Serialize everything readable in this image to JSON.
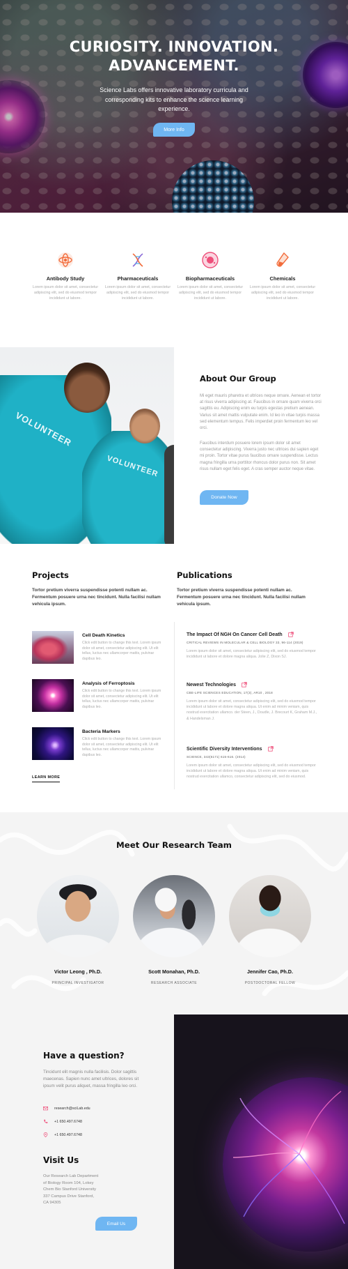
{
  "hero": {
    "title_line1": "CURIOSITY. INNOVATION.",
    "title_line2": "ADVANCEMENT.",
    "subtitle": "Science Labs offers innovative laboratory curricula and corresponding kits to enhance the science learning experience.",
    "button_label": "More Info"
  },
  "features": [
    {
      "title": "Antibody Study",
      "text": "Lorem ipsum dolor sit amet, consectetur adipiscing elit, sed do eiusmod tempor incididunt ut labore.",
      "icon": "atom-icon",
      "color": "#f26b3a"
    },
    {
      "title": "Pharmaceuticals",
      "text": "Lorem ipsum dolor sit amet, consectetur adipiscing elit, sed do eiusmod tempor incididunt ut labore.",
      "icon": "dna-icon",
      "color": "#8a6ad8"
    },
    {
      "title": "Biopharmaceuticals",
      "text": "Lorem ipsum dolor sit amet, consectetur adipiscing elit, sed do eiusmod tempor incididunt ut labore.",
      "icon": "cell-icon",
      "color": "#ee4f7a"
    },
    {
      "title": "Chemicals",
      "text": "Lorem ipsum dolor sit amet, consectetur adipiscing elit, sed do eiusmod tempor incididunt ut labore.",
      "icon": "flask-icon",
      "color": "#f26b3a"
    }
  ],
  "about": {
    "image_text_1": "VOLUNTEER",
    "image_text_2": "VOLUNTEER",
    "title": "About Our Group",
    "paragraph1": "Mi eget mauris pharetra et ultrices neque ornare. Aenean et tortor at risus viverra adipiscing at. Faucibus in ornare quam viverra orci sagittis eu. Adipiscing enim eu turpis egestas pretium aenean. Varius sit amet mattis vulputate enim. Id leo in vitae turpis massa sed elementum tempus. Felis imperdiet proin fermentum leo vel orci.",
    "paragraph2": "Faucibus interdum posuere lorem ipsum dolor sit amet consectetur adipiscing. Viverra justo nec ultrices dui sapien eget mi proin. Tortor vitae purus faucibus ornare suspendisse. Lectus magna fringilla urna porttitor rhoncus dolor purus non. Sit amet risus nullam eget felis eget. A cras semper auctor neque vitae.",
    "button_label": "Donate Now"
  },
  "projects": {
    "heading": "Projects",
    "intro": "Tortor pretium viverra suspendisse potenti nullam ac. Fermentum posuere urna nec tincidunt. Nulla facilisi nullam vehicula ipsum.",
    "items": [
      {
        "title": "Cell Death Kinetics",
        "text": "Click edit button to change this text. Lorem ipsum dolor sit amet, consectetur adipiscing elit. Ut elit tellus, luctus nec ullamcorper mattis, pulvinar dapibus leo."
      },
      {
        "title": "Analysis of Ferroptosis",
        "text": "Click edit button to change this text. Lorem ipsum dolor sit amet, consectetur adipiscing elit. Ut elit tellus, luctus nec ullamcorper mattis, pulvinar dapibus leo."
      },
      {
        "title": "Bacteria Markers",
        "text": "Click edit button to change this text. Lorem ipsum dolor sit amet, consectetur adipiscing elit. Ut elit tellus, luctus nec ullamcorper mattis, pulvinar dapibus leo."
      }
    ],
    "learn_more": "LEARN MORE"
  },
  "publications": {
    "heading": "Publications",
    "intro": "Tortor pretium viverra suspendisse potenti nullam ac. Fermentum posuere urna nec tincidunt. Nulla facilisi nullam vehicula ipsum.",
    "items": [
      {
        "title": "The Impact Of NGH On Cancer Cell Death",
        "meta": "CRITICAL REVIEWS IN MOLECULAR & CELL BIOLOGY 33, 96-114 (2019)",
        "text": "Lorem ipsum dolor sit amet, consectetur adipiscing elit, sed do eiusmod tempor incididunt ut labore et dolore magna aliqua. Jolie Z, Dixon SJ."
      },
      {
        "title": "Newest Technologies",
        "meta": "CBE-LIFE SCIENCES EDUCATION, 17(3), AR10 , 2018",
        "text": "Lorem ipsum dolor sit amet, consectetur adipiscing elit, sed do eiusmod tempor incididunt ut labore et dolore magna aliqua. Ut enim ad minim veniam, quis nostrud exercitation ullamco. der Steen, J., Doudle, J. Brecourt K, Graham M.J., & Handelsman J."
      },
      {
        "title": "Scientific Diversity Interventions",
        "meta": "SCIENCE, 343(6171) 615-616. (2014)",
        "text": "Lorem ipsum dolor sit amet, consectetur adipiscing elit, sed do eiusmod tempor incididunt ut labore et dolore magna aliqua. Ut enim ad minim veniam, quis nostrud exercitation ullamco, consectetur adipiscing elit, sed do eiusmod."
      }
    ]
  },
  "team": {
    "title": "Meet Our Research Team",
    "members": [
      {
        "name": "Victor Leong , Ph.D.",
        "role": "PRINCIPAL INVESTIGATOR"
      },
      {
        "name": "Scott Monahan, Ph.D.",
        "role": "RESEARCH ASSOCIATE"
      },
      {
        "name": "Jennifer Cao, Ph.D.",
        "role": "POSTDOCTORAL FELLOW"
      }
    ]
  },
  "contact": {
    "heading": "Have a question?",
    "text": "Tincidunt elit magnis nulla facilisis. Dolor sagittis maecenas. Sapien nunc amet ultrices, dolores sit ipsum velit purus aliquet, massa fringilla leo orci.",
    "email": "research@sciLab.edu",
    "phone1": "+1 650.497.6748",
    "phone2": "+1 650.497.6748",
    "visit_heading": "Visit Us",
    "address": "Our Research Lab Department of Biology Room 104, Lokey Chem Bio Stanford University 337 Campus Drive Stanford, CA 94305",
    "button_label": "Email Us"
  },
  "colors": {
    "accent": "#6fb6f2",
    "icon_orange": "#f26b3a",
    "icon_purple": "#8a6ad8",
    "icon_pink": "#ee4f7a"
  }
}
